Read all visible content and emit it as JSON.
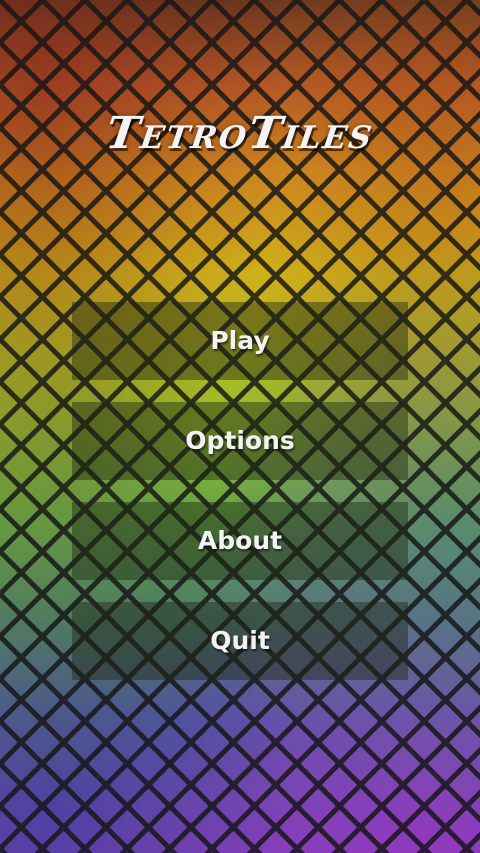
{
  "app": {
    "title": "TetroTiles"
  },
  "menu": {
    "items": [
      {
        "label": "Play"
      },
      {
        "label": "Options"
      },
      {
        "label": "About"
      },
      {
        "label": "Quit"
      }
    ]
  },
  "background": {
    "pattern": "diagonal-tile-mosaic",
    "colors": [
      "#b4501a",
      "#d38a12",
      "#d1b80c",
      "#9ab81c",
      "#5ea436",
      "#3c7c5e",
      "#4a4e9c",
      "#7a34b6"
    ],
    "grout_color": "#1e1e1e"
  }
}
